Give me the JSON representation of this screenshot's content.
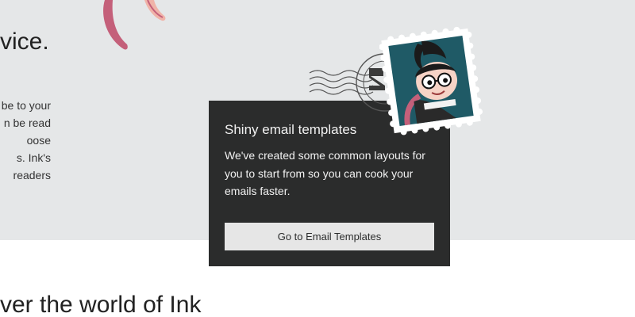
{
  "background": {
    "heading_fragment": "vice.",
    "body_fragments": [
      "be to your",
      "n be read",
      "oose",
      "s. Ink's",
      "readers"
    ],
    "bottom_heading": "ver the world of Ink"
  },
  "popup": {
    "title": "Shiny email templates",
    "body": "We've created some common layouts for you to start from so you can cook your emails faster.",
    "button_label": "Go to Email Templates"
  },
  "colors": {
    "band_bg": "#e5e7e8",
    "popup_bg": "#2b2c2c",
    "button_bg": "#e6e6e6",
    "stamp_bg": "#1f5a66",
    "tentacle": "#c4607a"
  },
  "icons": [
    "tentacle-illustration",
    "postmark-icon",
    "stamp-illustration"
  ]
}
